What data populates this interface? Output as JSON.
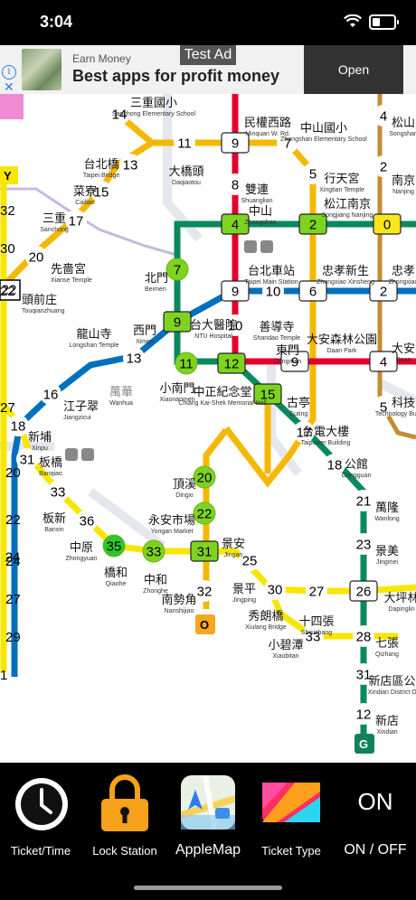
{
  "status_bar": {
    "time": "3:04"
  },
  "ad": {
    "badge": "Test Ad",
    "eyebrow": "Earn Money",
    "headline": "Best apps for profit money",
    "cta": "Open"
  },
  "map": {
    "station_labels": [
      {
        "id": "s1",
        "text": "三重國小",
        "sub": "Sanchong Elementary School"
      },
      {
        "id": "s2",
        "text": "台北橋",
        "sub": "Taipei Bridge"
      },
      {
        "id": "s3",
        "text": "大橋頭",
        "sub": "Daqiaotou"
      },
      {
        "id": "s4",
        "text": "菜寮",
        "sub": "Cailiao"
      },
      {
        "id": "s5",
        "text": "三重",
        "sub": "Sanchong"
      },
      {
        "id": "s6",
        "text": "先嗇宮",
        "sub": "Xianse Temple"
      },
      {
        "id": "s7",
        "text": "頭前庄",
        "sub": "Touqianzhuang"
      },
      {
        "id": "s8",
        "text": "民權西路",
        "sub": "Minquan W. Rd."
      },
      {
        "id": "s9",
        "text": "雙連",
        "sub": "Shuanglian"
      },
      {
        "id": "s10",
        "text": "中山",
        "sub": "Zhongshan"
      },
      {
        "id": "s11",
        "text": "中山國小",
        "sub": "Zhongshan Elementary School"
      },
      {
        "id": "s12",
        "text": "行天宮",
        "sub": "Xingtian Temple"
      },
      {
        "id": "s13",
        "text": "松江南京",
        "sub": "Songjiang Nanjing"
      },
      {
        "id": "s14",
        "text": "台北車站",
        "sub": "Taipei Main Station"
      },
      {
        "id": "s15",
        "text": "北門",
        "sub": "Beimen"
      },
      {
        "id": "s16",
        "text": "忠孝新生",
        "sub": "Zhongxiao Xinsheng"
      },
      {
        "id": "s17",
        "text": "善導寺",
        "sub": "Shandao Temple"
      },
      {
        "id": "s18",
        "text": "西門",
        "sub": "Ximen"
      },
      {
        "id": "s19",
        "text": "台大醫院",
        "sub": "NTU Hospital"
      },
      {
        "id": "s20",
        "text": "龍山寺",
        "sub": "Longshan Temple"
      },
      {
        "id": "s21",
        "text": "東門",
        "sub": "Dongmen"
      },
      {
        "id": "s22",
        "text": "大安森林公園",
        "sub": "Daan Park"
      },
      {
        "id": "s23",
        "text": "小南門",
        "sub": "Xiaonanmen"
      },
      {
        "id": "s24",
        "text": "中正紀念堂",
        "sub": "Chiang Kai-Shek Memorial Hall"
      },
      {
        "id": "s25",
        "text": "古亭",
        "sub": "Guting"
      },
      {
        "id": "s26",
        "text": "江子翠",
        "sub": "Jiangzicui"
      },
      {
        "id": "s27",
        "text": "新埔",
        "sub": "Xinpu"
      },
      {
        "id": "s28",
        "text": "板橋",
        "sub": "Banqiao"
      },
      {
        "id": "s29",
        "text": "台電大樓",
        "sub": "Taipower Building"
      },
      {
        "id": "s30",
        "text": "公館",
        "sub": "Gongguan"
      },
      {
        "id": "s31",
        "text": "頂溪",
        "sub": "Dingxi"
      },
      {
        "id": "s32",
        "text": "永安市場",
        "sub": "Yongan Market"
      },
      {
        "id": "s33",
        "text": "景安",
        "sub": "Jingan"
      },
      {
        "id": "s34",
        "text": "板新",
        "sub": "Banxin"
      },
      {
        "id": "s35",
        "text": "中原",
        "sub": "Zhongyuan"
      },
      {
        "id": "s36",
        "text": "橋和",
        "sub": "Qiaohe"
      },
      {
        "id": "s37",
        "text": "中和",
        "sub": "Zhonghe"
      },
      {
        "id": "s38",
        "text": "南勢角",
        "sub": "Nanshijiao"
      },
      {
        "id": "s39",
        "text": "景平",
        "sub": "Jingping"
      },
      {
        "id": "s40",
        "text": "秀朗橋",
        "sub": "Xiulang Bridge"
      },
      {
        "id": "s41",
        "text": "十四張",
        "sub": "Shisizhang"
      },
      {
        "id": "s42",
        "text": "小碧潭",
        "sub": "Xiaobitan"
      },
      {
        "id": "s43",
        "text": "萬隆",
        "sub": "Wanlong"
      },
      {
        "id": "s44",
        "text": "景美",
        "sub": "Jingmei"
      },
      {
        "id": "s45",
        "text": "大坪林",
        "sub": "Dapinglin"
      },
      {
        "id": "s46",
        "text": "七張",
        "sub": "Qizhang"
      },
      {
        "id": "s47",
        "text": "新店區公所",
        "sub": "Xindian District Office"
      },
      {
        "id": "s48",
        "text": "新店",
        "sub": "Xindian"
      },
      {
        "id": "s49",
        "text": "松山",
        "sub": "Songshan"
      },
      {
        "id": "s50",
        "text": "南京",
        "sub": "Nanjing"
      },
      {
        "id": "s51",
        "text": "忠孝",
        "sub": "Zhongxiao"
      },
      {
        "id": "s52",
        "text": "大安",
        "sub": "Daan"
      },
      {
        "id": "s53",
        "text": "科技",
        "sub": "Technology Building"
      },
      {
        "id": "s54",
        "text": "萬華",
        "sub": "Wanhua"
      },
      {
        "id": "s55",
        "text": "三重",
        "sub": "Sanchong"
      }
    ],
    "edge_labels": [
      "Y",
      "32",
      "30",
      "22",
      "27",
      "20",
      "22",
      "24",
      "27",
      "29",
      "1"
    ],
    "line_badges": [
      {
        "id": "o",
        "text": "O",
        "color": "#f5a623"
      },
      {
        "id": "g",
        "text": "G",
        "color": "#10825a"
      }
    ],
    "station_numbers": [
      "14",
      "11",
      "9",
      "7",
      "4",
      "2",
      "13",
      "15",
      "8",
      "5",
      "17",
      "4",
      "2",
      "0",
      "20",
      "7",
      "9",
      "10",
      "6",
      "2",
      "22",
      "9",
      "10",
      "13",
      "9",
      "4",
      "16",
      "11",
      "12",
      "15",
      "5",
      "18",
      "31",
      "17",
      "18",
      "20",
      "33",
      "22",
      "21",
      "36",
      "24",
      "23",
      "35",
      "33",
      "31",
      "25",
      "26",
      "32",
      "30",
      "27",
      "33",
      "28",
      "31",
      "12",
      "2"
    ],
    "colors": {
      "red": "#e3002c",
      "orange": "#f5b800",
      "green": "#0a8a5c",
      "blue": "#0070bd",
      "yellow": "#f7e600",
      "brown": "#c48c31"
    }
  },
  "toolbar": {
    "items": [
      {
        "id": "ticket_time",
        "label": "Ticket/Time"
      },
      {
        "id": "lock_station",
        "label": "Lock Station"
      },
      {
        "id": "apple_map",
        "label": "AppleMap"
      },
      {
        "id": "ticket_type",
        "label": "Ticket Type"
      },
      {
        "id": "on_off",
        "label": "ON / OFF",
        "state_text": "ON"
      }
    ]
  }
}
